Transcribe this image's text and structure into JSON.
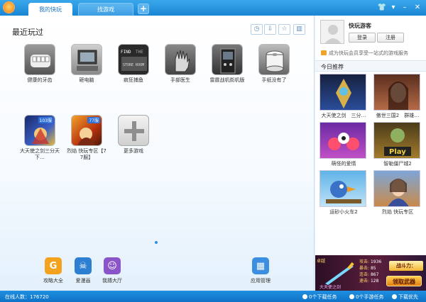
{
  "tabs": [
    {
      "label": "我的快玩",
      "active": true
    },
    {
      "label": "找游戏",
      "active": false
    }
  ],
  "tab_add": "+",
  "window_controls": [
    "👕",
    "▾",
    "–",
    "✕"
  ],
  "main": {
    "section_title": "最近玩过",
    "toolbar_icons": [
      "clock-icon",
      "download-icon",
      "star-icon",
      "trash-icon"
    ],
    "games": [
      {
        "name": "健康的牙齿",
        "icon": "teeth-icon",
        "thumb_text": ""
      },
      {
        "name": "砸电脑",
        "icon": "computer-icon",
        "thumb_text": ""
      },
      {
        "name": "疯狂捕鱼",
        "icon": "storeroom-icon",
        "thumb_text": "FIND STORE ROOM"
      },
      {
        "name": "手部医生",
        "icon": "hand-icon",
        "thumb_text": ""
      },
      {
        "name": "雷霆战机街机版",
        "icon": "arcade-icon",
        "thumb_text": ""
      },
      {
        "name": "手纸没有了",
        "icon": "tissue-icon",
        "thumb_text": ""
      },
      {
        "name": "大天使之剑三分天下…",
        "icon": "angel-sword-icon",
        "thumb_text": "103服"
      },
      {
        "name": "烈焰 快玩专区【77服】",
        "icon": "flame-icon",
        "thumb_text": "77服"
      },
      {
        "name": "更多游戏",
        "icon": "plus-icon",
        "thumb_text": "+"
      }
    ]
  },
  "dock": [
    {
      "label": "攻略大全",
      "icon": "guide-icon",
      "glyph": "G",
      "color": "#f3a21e"
    },
    {
      "label": "爱漫画",
      "icon": "comic-icon",
      "glyph": "☠",
      "color": "#2d7fd1"
    },
    {
      "label": "我搏大厅",
      "icon": "chat-icon",
      "glyph": "☺",
      "color": "#8a55c9"
    },
    {
      "label": "应用管理",
      "icon": "app-manager-icon",
      "glyph": "▦",
      "color": "#3b8ee0"
    }
  ],
  "sidebar": {
    "username": "快玩游客",
    "login": "登录",
    "register": "注册",
    "promo": "成为快玩会员享受一站式的游戏服务",
    "recommend_title": "今日推荐",
    "recommend": [
      {
        "name": "大天使之剑　三分…",
        "icon": "angel-warrior-icon"
      },
      {
        "name": "傲世三国2　群雄…",
        "icon": "beauty-icon"
      },
      {
        "name": "萌怪的爱情",
        "icon": "monster-love-icon"
      },
      {
        "name": "智勒僵尸城2",
        "icon": "zombie-play-icon"
      },
      {
        "name": "运砂小火车2",
        "icon": "train-bird-icon"
      },
      {
        "name": "烈焰 快玩专区",
        "icon": "flame-girl-icon"
      }
    ],
    "banner": {
      "label": "卓越",
      "stats": [
        {
          "k": "攻击:",
          "v": "1936"
        },
        {
          "k": "暴击:",
          "v": "85"
        },
        {
          "k": "连击:",
          "v": "867"
        },
        {
          "k": "速击:",
          "v": "128"
        }
      ],
      "gold": "战斗力：",
      "cta": "领取武器",
      "sub": "大天使之剑"
    }
  },
  "status": {
    "online_label": "在线人数：",
    "online_count": "176720",
    "download_tasks": "0个下载任务",
    "mobile_tasks": "0个手游任务",
    "download_priority": "下载优先"
  },
  "colors": {
    "accent": "#1a86d4",
    "tab_text": "#1b74c2"
  }
}
